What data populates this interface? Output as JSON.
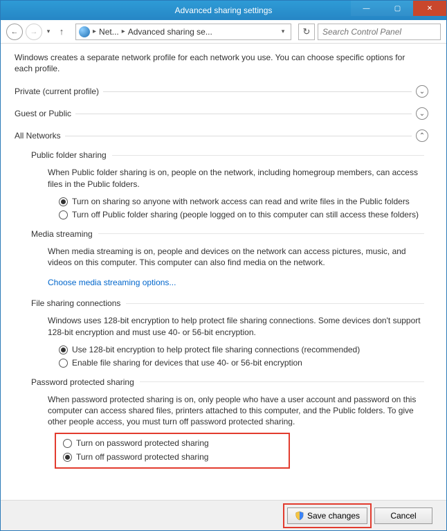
{
  "window": {
    "title": "Advanced sharing settings"
  },
  "nav": {
    "crumb1": "Net...",
    "crumb2": "Advanced sharing se...",
    "search_placeholder": "Search Control Panel"
  },
  "intro": "Windows creates a separate network profile for each network you use. You can choose specific options for each profile.",
  "sections": {
    "private": {
      "label": "Private (current profile)"
    },
    "guest": {
      "label": "Guest or Public"
    },
    "all": {
      "label": "All Networks"
    }
  },
  "public_folder": {
    "header": "Public folder sharing",
    "desc": "When Public folder sharing is on, people on the network, including homegroup members, can access files in the Public folders.",
    "opt1": "Turn on sharing so anyone with network access can read and write files in the Public folders",
    "opt2": "Turn off Public folder sharing (people logged on to this computer can still access these folders)"
  },
  "media": {
    "header": "Media streaming",
    "desc": "When media streaming is on, people and devices on the network can access pictures, music, and videos on this computer. This computer can also find media on the network.",
    "link": "Choose media streaming options..."
  },
  "fileconn": {
    "header": "File sharing connections",
    "desc": "Windows uses 128-bit encryption to help protect file sharing connections. Some devices don't support 128-bit encryption and must use 40- or 56-bit encryption.",
    "opt1": "Use 128-bit encryption to help protect file sharing connections (recommended)",
    "opt2": "Enable file sharing for devices that use 40- or 56-bit encryption"
  },
  "password": {
    "header": "Password protected sharing",
    "desc": "When password protected sharing is on, only people who have a user account and password on this computer can access shared files, printers attached to this computer, and the Public folders. To give other people access, you must turn off password protected sharing.",
    "opt1": "Turn on password protected sharing",
    "opt2": "Turn off password protected sharing"
  },
  "footer": {
    "save": "Save changes",
    "cancel": "Cancel"
  }
}
